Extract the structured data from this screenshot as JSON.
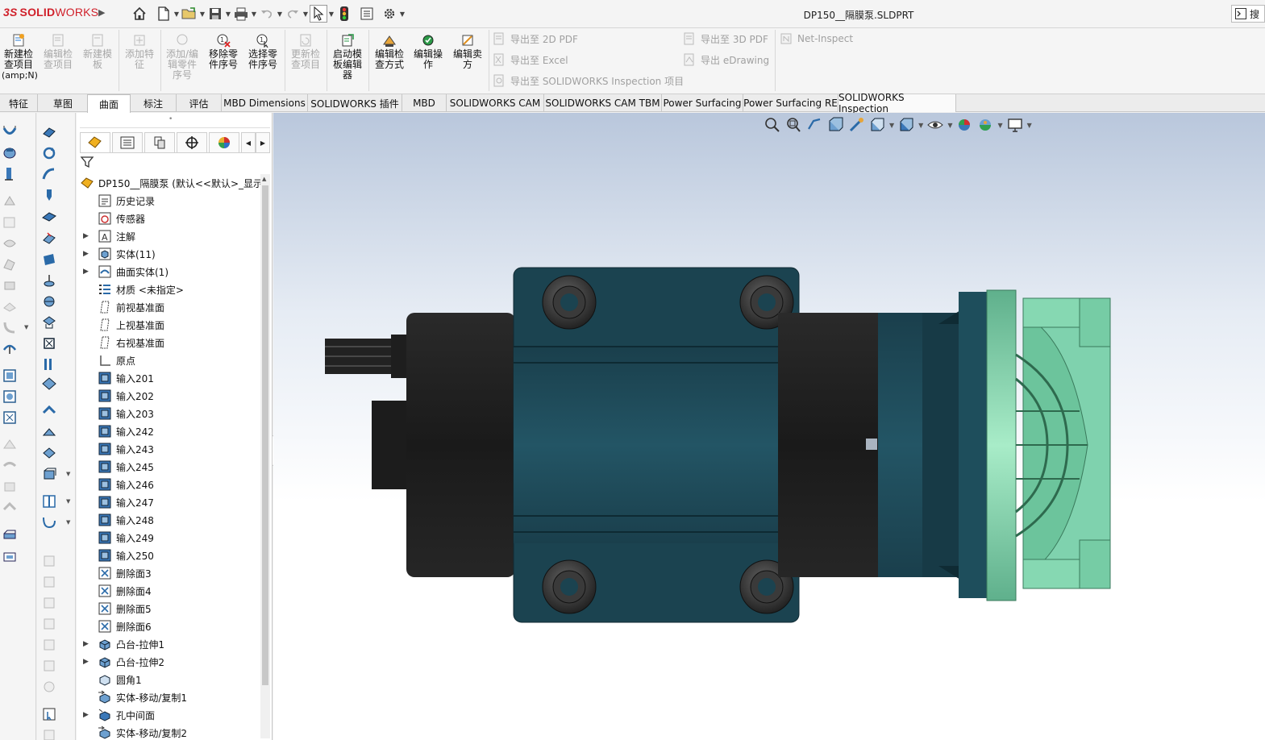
{
  "app": {
    "logo_prefix": "3S",
    "logo_solid": "SOLID",
    "logo_works": "WORKS",
    "document_title": "DP150__隔膜泵.SLDPRT",
    "search_label": "搜"
  },
  "ribbon": {
    "buttons": [
      {
        "label_l1": "新建检",
        "label_l2": "查项目",
        "label_l3": "(amp;N)",
        "disabled": false
      },
      {
        "label_l1": "编辑检",
        "label_l2": "查项目",
        "disabled": true
      },
      {
        "label_l1": "新建模",
        "label_l2": "板",
        "disabled": true
      },
      {
        "label_l1": "添加特",
        "label_l2": "征",
        "disabled": true
      },
      {
        "label_l1": "添加/编",
        "label_l2": "辑零件",
        "label_l3": "序号",
        "disabled": true
      },
      {
        "label_l1": "移除零",
        "label_l2": "件序号",
        "disabled": false
      },
      {
        "label_l1": "选择零",
        "label_l2": "件序号",
        "disabled": false
      },
      {
        "label_l1": "更新检",
        "label_l2": "查项目",
        "disabled": true
      },
      {
        "label_l1": "启动模",
        "label_l2": "板编辑",
        "label_l3": "器",
        "disabled": false
      },
      {
        "label_l1": "编辑检",
        "label_l2": "查方式",
        "disabled": false
      },
      {
        "label_l1": "编辑操",
        "label_l2": "作",
        "disabled": false
      },
      {
        "label_l1": "编辑卖",
        "label_l2": "方",
        "disabled": false
      }
    ],
    "export": {
      "pdf2d": "导出至 2D PDF",
      "excel": "导出至 Excel",
      "inspection": "导出至 SOLIDWORKS Inspection 项目",
      "pdf3d": "导出至 3D PDF",
      "edrawing": "导出 eDrawing",
      "net_inspect": "Net-Inspect"
    }
  },
  "tabs": [
    {
      "label": "特征",
      "active": false
    },
    {
      "label": "草图",
      "active": false
    },
    {
      "label": "曲面",
      "active": true
    },
    {
      "label": "标注",
      "active": false
    },
    {
      "label": "评估",
      "active": false
    },
    {
      "label": "MBD Dimensions",
      "active": false
    },
    {
      "label": "SOLIDWORKS 插件",
      "active": false
    },
    {
      "label": "MBD",
      "active": false
    },
    {
      "label": "SOLIDWORKS CAM",
      "active": false
    },
    {
      "label": "SOLIDWORKS CAM TBM",
      "active": false
    },
    {
      "label": "Power Surfacing",
      "active": false
    },
    {
      "label": "Power Surfacing RE",
      "active": false
    },
    {
      "label": "SOLIDWORKS Inspection",
      "active": false
    }
  ],
  "feature_tree": {
    "root": "DP150__隔膜泵 (默认<<默认>_显示",
    "items": [
      {
        "label": "历史记录",
        "icon": "history-icon",
        "expandable": false
      },
      {
        "label": "传感器",
        "icon": "sensor-icon",
        "expandable": false
      },
      {
        "label": "注解",
        "icon": "annotation-icon",
        "expandable": true
      },
      {
        "label": "实体(11)",
        "icon": "solid-bodies-icon",
        "expandable": true
      },
      {
        "label": "曲面实体(1)",
        "icon": "surface-bodies-icon",
        "expandable": true
      },
      {
        "label": "材质 <未指定>",
        "icon": "material-icon",
        "expandable": false
      },
      {
        "label": "前视基准面",
        "icon": "plane-icon",
        "expandable": false
      },
      {
        "label": "上视基准面",
        "icon": "plane-icon",
        "expandable": false
      },
      {
        "label": "右视基准面",
        "icon": "plane-icon",
        "expandable": false
      },
      {
        "label": "原点",
        "icon": "origin-icon",
        "expandable": false
      },
      {
        "label": "输入201",
        "icon": "imported-body-icon",
        "expandable": false
      },
      {
        "label": "输入202",
        "icon": "imported-body-icon",
        "expandable": false
      },
      {
        "label": "输入203",
        "icon": "imported-body-icon",
        "expandable": false
      },
      {
        "label": "输入242",
        "icon": "imported-body-icon",
        "expandable": false
      },
      {
        "label": "输入243",
        "icon": "imported-body-icon",
        "expandable": false
      },
      {
        "label": "输入245",
        "icon": "imported-body-icon",
        "expandable": false
      },
      {
        "label": "输入246",
        "icon": "imported-body-icon",
        "expandable": false
      },
      {
        "label": "输入247",
        "icon": "imported-body-icon",
        "expandable": false
      },
      {
        "label": "输入248",
        "icon": "imported-body-icon",
        "expandable": false
      },
      {
        "label": "输入249",
        "icon": "imported-body-icon",
        "expandable": false
      },
      {
        "label": "输入250",
        "icon": "imported-body-icon",
        "expandable": false
      },
      {
        "label": "删除面3",
        "icon": "delete-face-icon",
        "expandable": false
      },
      {
        "label": "删除面4",
        "icon": "delete-face-icon",
        "expandable": false
      },
      {
        "label": "删除面5",
        "icon": "delete-face-icon",
        "expandable": false
      },
      {
        "label": "删除面6",
        "icon": "delete-face-icon",
        "expandable": false
      },
      {
        "label": "凸台-拉伸1",
        "icon": "extrude-boss-icon",
        "expandable": true
      },
      {
        "label": "凸台-拉伸2",
        "icon": "extrude-boss-icon",
        "expandable": true
      },
      {
        "label": "圆角1",
        "icon": "fillet-icon",
        "expandable": false
      },
      {
        "label": "实体-移动/复制1",
        "icon": "move-copy-body-icon",
        "expandable": false
      },
      {
        "label": "孔中间面",
        "icon": "mid-surface-icon",
        "expandable": true
      },
      {
        "label": "实体-移动/复制2",
        "icon": "move-copy-body-icon",
        "expandable": false
      }
    ]
  },
  "colors": {
    "motor_body": "#1c1c1c",
    "housing_teal": "#1f4f5e",
    "pump_head": "#86d8b2",
    "viewport_top": "#b9c7dc"
  }
}
